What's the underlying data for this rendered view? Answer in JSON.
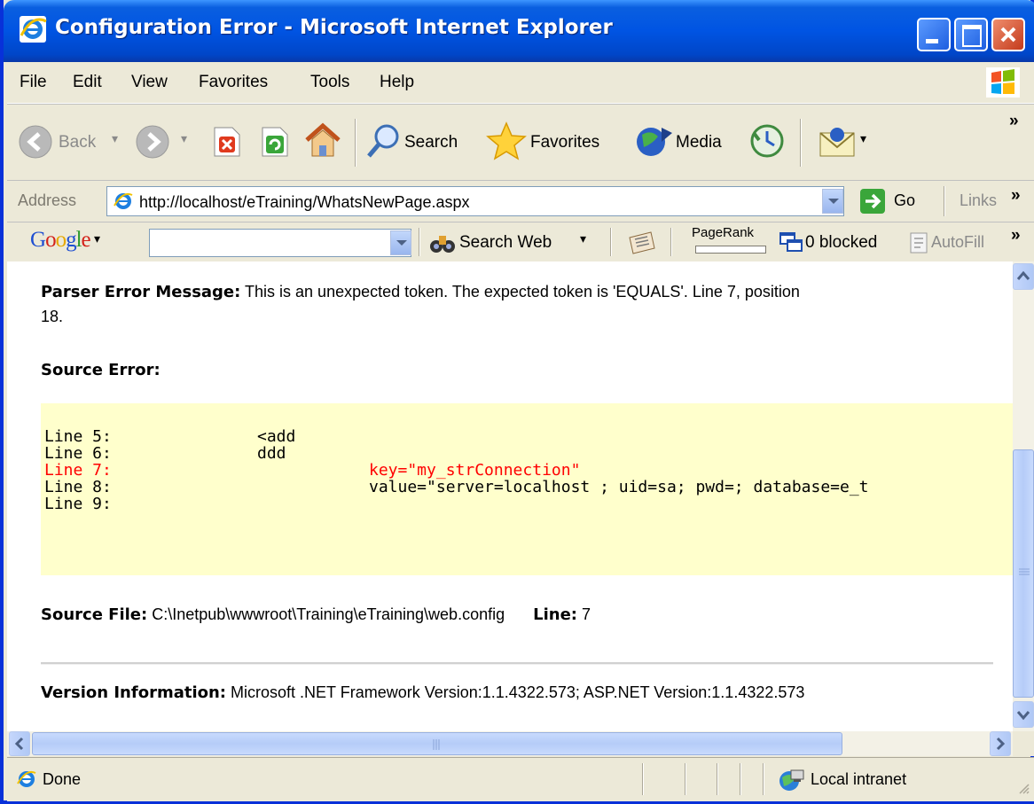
{
  "window": {
    "title": "Configuration Error - Microsoft Internet Explorer"
  },
  "menu": {
    "file": "File",
    "edit": "Edit",
    "view": "View",
    "favorites": "Favorites",
    "tools": "Tools",
    "help": "Help"
  },
  "toolbar": {
    "back": "Back",
    "search": "Search",
    "favorites": "Favorites",
    "media": "Media",
    "overflow": "»"
  },
  "address": {
    "label": "Address",
    "url": "http://localhost/eTraining/WhatsNewPage.aspx",
    "go": "Go",
    "links": "Links",
    "overflow": "»"
  },
  "googlebar": {
    "logo_letters": [
      "G",
      "o",
      "o",
      "g",
      "l",
      "e"
    ],
    "search_web": "Search Web",
    "pagerank": "PageRank",
    "blocked": "0 blocked",
    "autofill": "AutoFill",
    "overflow": "»"
  },
  "page": {
    "parser_label": "Parser Error Message:",
    "parser_message": "This is an unexpected token. The expected token is 'EQUALS'. Line 7, position",
    "parser_message_cont": "18.",
    "source_error_label": "Source Error:",
    "code_lines": [
      {
        "line": "Line 5:",
        "code": "<add",
        "indent": "mid",
        "highlight": false
      },
      {
        "line": "Line 6:",
        "code": "ddd",
        "indent": "mid",
        "highlight": false
      },
      {
        "line": "Line 7:",
        "code": "key=\"my_strConnection\"",
        "indent": "deep",
        "highlight": true
      },
      {
        "line": "Line 8:",
        "code": "value=\"server=localhost ; uid=sa; pwd=; database=e_t",
        "indent": "deep",
        "highlight": false
      },
      {
        "line": "Line 9:",
        "code": "",
        "indent": "mid",
        "highlight": false
      }
    ],
    "source_file_label": "Source File:",
    "source_file_value": "C:\\Inetpub\\wwwroot\\Training\\eTraining\\web.config",
    "line_label": "Line:",
    "line_value": "7",
    "version_label": "Version Information:",
    "version_value": "Microsoft .NET Framework Version:1.1.4322.573; ASP.NET Version:1.1.4322.573"
  },
  "status": {
    "text": "Done",
    "zone": "Local intranet"
  },
  "colors": {
    "titlebar": "#0054e3",
    "code_background": "#ffffcc",
    "error_line": "#ff0000"
  }
}
